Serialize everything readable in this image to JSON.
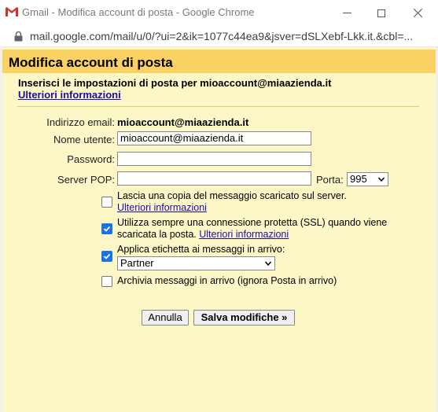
{
  "window": {
    "title": "Gmail - Modifica account di posta - Google Chrome",
    "url": "mail.google.com/mail/u/0/?ui=2&ik=1077c44ea9&jsver=dSLXebf-Lkk.it.&cbl=..."
  },
  "dialog": {
    "title": "Modifica account di posta",
    "intro_prefix": "Inserisci le impostazioni di posta per ",
    "intro_email": "mioaccount@miaazienda.it",
    "more_info_link": "Ulteriori informazioni",
    "form": {
      "email_label": "Indirizzo email:",
      "email_value": "mioaccount@miaazienda.it",
      "username_label": "Nome utente:",
      "username_value": "mioaccount@miaazienda.it",
      "password_label": "Password:",
      "password_value": "",
      "pop_label": "Server POP:",
      "pop_value": "",
      "port_label": "Porta:",
      "port_value": "995"
    },
    "options": {
      "leave_copy": {
        "checked": false,
        "text": "Lascia una copia del messaggio scaricato sul server.",
        "link": "Ulteriori informazioni"
      },
      "ssl": {
        "checked": true,
        "text1": "Utilizza sempre una connessione protetta (SSL) quando viene",
        "text2": "scaricata la posta.",
        "link": "Ulteriori informazioni"
      },
      "label": {
        "checked": true,
        "text": "Applica etichetta ai messaggi in arrivo:",
        "selected": "Partner"
      },
      "archive": {
        "checked": false,
        "text": "Archivia messaggi in arrivo (ignora Posta in arrivo)"
      }
    },
    "buttons": {
      "cancel": "Annulla",
      "save": "Salva modifiche »"
    }
  },
  "colors": {
    "header": "#fad163",
    "dialog_bg": "#fdf6c6",
    "link": "#1a0dab",
    "checkbox": "#1a73e8"
  }
}
